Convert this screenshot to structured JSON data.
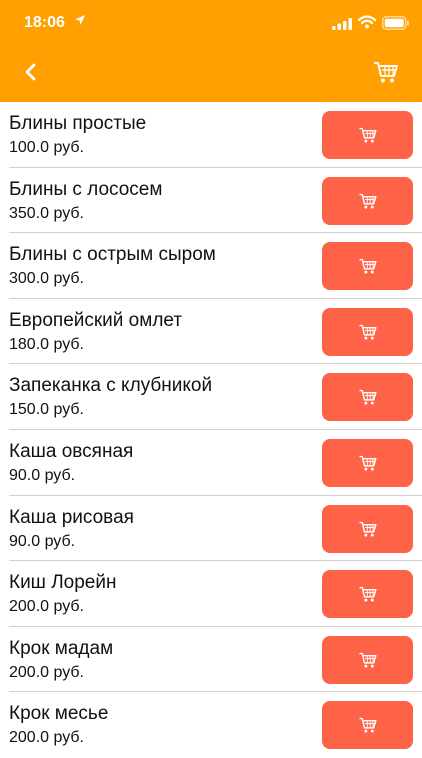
{
  "status_bar": {
    "time": "18:06"
  },
  "nav": {
    "back_icon": "chevron-left-icon",
    "cart_icon": "cart-icon"
  },
  "colors": {
    "header": "#ff9f00",
    "button": "#ff6347"
  },
  "products": [
    {
      "name": "Блины простые",
      "price": "100.0 руб."
    },
    {
      "name": "Блины с лососем",
      "price": "350.0 руб."
    },
    {
      "name": "Блины с острым сыром",
      "price": "300.0 руб."
    },
    {
      "name": "Европейский омлет",
      "price": "180.0 руб."
    },
    {
      "name": "Запеканка с клубникой",
      "price": "150.0 руб."
    },
    {
      "name": "Каша овсяная",
      "price": "90.0 руб."
    },
    {
      "name": "Каша рисовая",
      "price": "90.0 руб."
    },
    {
      "name": "Киш Лорейн",
      "price": "200.0 руб."
    },
    {
      "name": "Крок мадам",
      "price": "200.0 руб."
    },
    {
      "name": "Крок месье",
      "price": "200.0 руб."
    }
  ]
}
